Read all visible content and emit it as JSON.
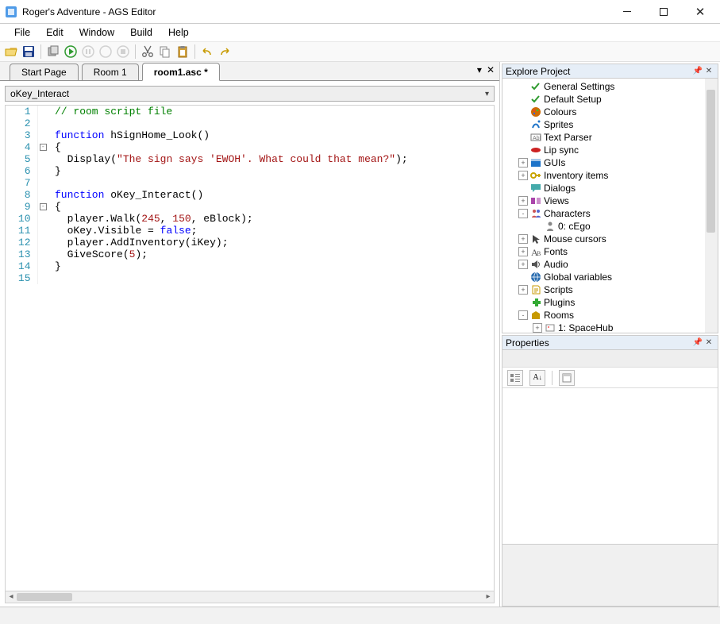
{
  "window": {
    "title": "Roger's Adventure - AGS Editor"
  },
  "menu": [
    "File",
    "Edit",
    "Window",
    "Build",
    "Help"
  ],
  "tabs": [
    {
      "label": "Start Page",
      "active": false
    },
    {
      "label": "Room 1",
      "active": false
    },
    {
      "label": "room1.asc *",
      "active": true
    }
  ],
  "funcbar": {
    "value": "oKey_Interact"
  },
  "code": {
    "lines": [
      {
        "n": 1,
        "fold": "",
        "html": "<span class='comment'>// room script file</span>"
      },
      {
        "n": 2,
        "fold": "",
        "html": ""
      },
      {
        "n": 3,
        "fold": "",
        "html": "<span class='kw'>function</span> <span class='iden'>hSignHome_Look</span>()"
      },
      {
        "n": 4,
        "fold": "-",
        "html": "{"
      },
      {
        "n": 5,
        "fold": "",
        "html": "  <span class='iden'>Display</span>(<span class='str'>\"The sign says 'EWOH'. What could that mean?\"</span>);"
      },
      {
        "n": 6,
        "fold": "",
        "html": "}"
      },
      {
        "n": 7,
        "fold": "",
        "html": ""
      },
      {
        "n": 8,
        "fold": "",
        "html": "<span class='kw'>function</span> <span class='iden'>oKey_Interact</span>()"
      },
      {
        "n": 9,
        "fold": "-",
        "html": "{"
      },
      {
        "n": 10,
        "fold": "",
        "html": "  <span class='iden'>player</span>.<span class='iden'>Walk</span>(<span class='num'>245</span>, <span class='num'>150</span>, <span class='iden'>eBlock</span>);"
      },
      {
        "n": 11,
        "fold": "",
        "html": "  <span class='iden'>oKey</span>.<span class='iden'>Visible</span> = <span class='kw'>false</span>;"
      },
      {
        "n": 12,
        "fold": "",
        "html": "  <span class='iden'>player</span>.<span class='iden'>AddInventory</span>(<span class='iden'>iKey</span>);"
      },
      {
        "n": 13,
        "fold": "",
        "html": "  <span class='iden'>GiveScore</span>(<span class='num'>5</span>);"
      },
      {
        "n": 14,
        "fold": "",
        "html": "}"
      },
      {
        "n": 15,
        "fold": "",
        "html": ""
      }
    ]
  },
  "explorer": {
    "title": "Explore Project",
    "items": [
      {
        "label": "General Settings",
        "indent": 1,
        "exp": "",
        "icon": "check",
        "color": "#2e9a2e"
      },
      {
        "label": "Default Setup",
        "indent": 1,
        "exp": "",
        "icon": "check",
        "color": "#2e9a2e"
      },
      {
        "label": "Colours",
        "indent": 1,
        "exp": "",
        "icon": "palette",
        "color": "#d06a00"
      },
      {
        "label": "Sprites",
        "indent": 1,
        "exp": "",
        "icon": "sprite",
        "color": "#1e74c9"
      },
      {
        "label": "Text Parser",
        "indent": 1,
        "exp": "",
        "icon": "parser",
        "color": "#777"
      },
      {
        "label": "Lip sync",
        "indent": 1,
        "exp": "",
        "icon": "lips",
        "color": "#c22"
      },
      {
        "label": "GUIs",
        "indent": 1,
        "exp": "+",
        "icon": "gui",
        "color": "#1e74c9"
      },
      {
        "label": "Inventory items",
        "indent": 1,
        "exp": "+",
        "icon": "key",
        "color": "#c9a400"
      },
      {
        "label": "Dialogs",
        "indent": 1,
        "exp": "",
        "icon": "dialog",
        "color": "#4aa"
      },
      {
        "label": "Views",
        "indent": 1,
        "exp": "+",
        "icon": "views",
        "color": "#aa44aa"
      },
      {
        "label": "Characters",
        "indent": 1,
        "exp": "-",
        "icon": "chars",
        "color": "#c55"
      },
      {
        "label": "0: cEgo",
        "indent": 2,
        "exp": "",
        "icon": "person",
        "color": "#888"
      },
      {
        "label": "Mouse cursors",
        "indent": 1,
        "exp": "+",
        "icon": "cursor",
        "color": "#444"
      },
      {
        "label": "Fonts",
        "indent": 1,
        "exp": "+",
        "icon": "font",
        "color": "#555"
      },
      {
        "label": "Audio",
        "indent": 1,
        "exp": "+",
        "icon": "audio",
        "color": "#555"
      },
      {
        "label": "Global variables",
        "indent": 1,
        "exp": "",
        "icon": "globe",
        "color": "#2a6db0"
      },
      {
        "label": "Scripts",
        "indent": 1,
        "exp": "+",
        "icon": "script",
        "color": "#c79a00"
      },
      {
        "label": "Plugins",
        "indent": 1,
        "exp": "",
        "icon": "plugin",
        "color": "#3a3"
      },
      {
        "label": "Rooms",
        "indent": 1,
        "exp": "-",
        "icon": "rooms",
        "color": "#c79a00"
      },
      {
        "label": "1: SpaceHub",
        "indent": 2,
        "exp": "+",
        "icon": "room",
        "color": "#888"
      }
    ]
  },
  "properties": {
    "title": "Properties"
  }
}
